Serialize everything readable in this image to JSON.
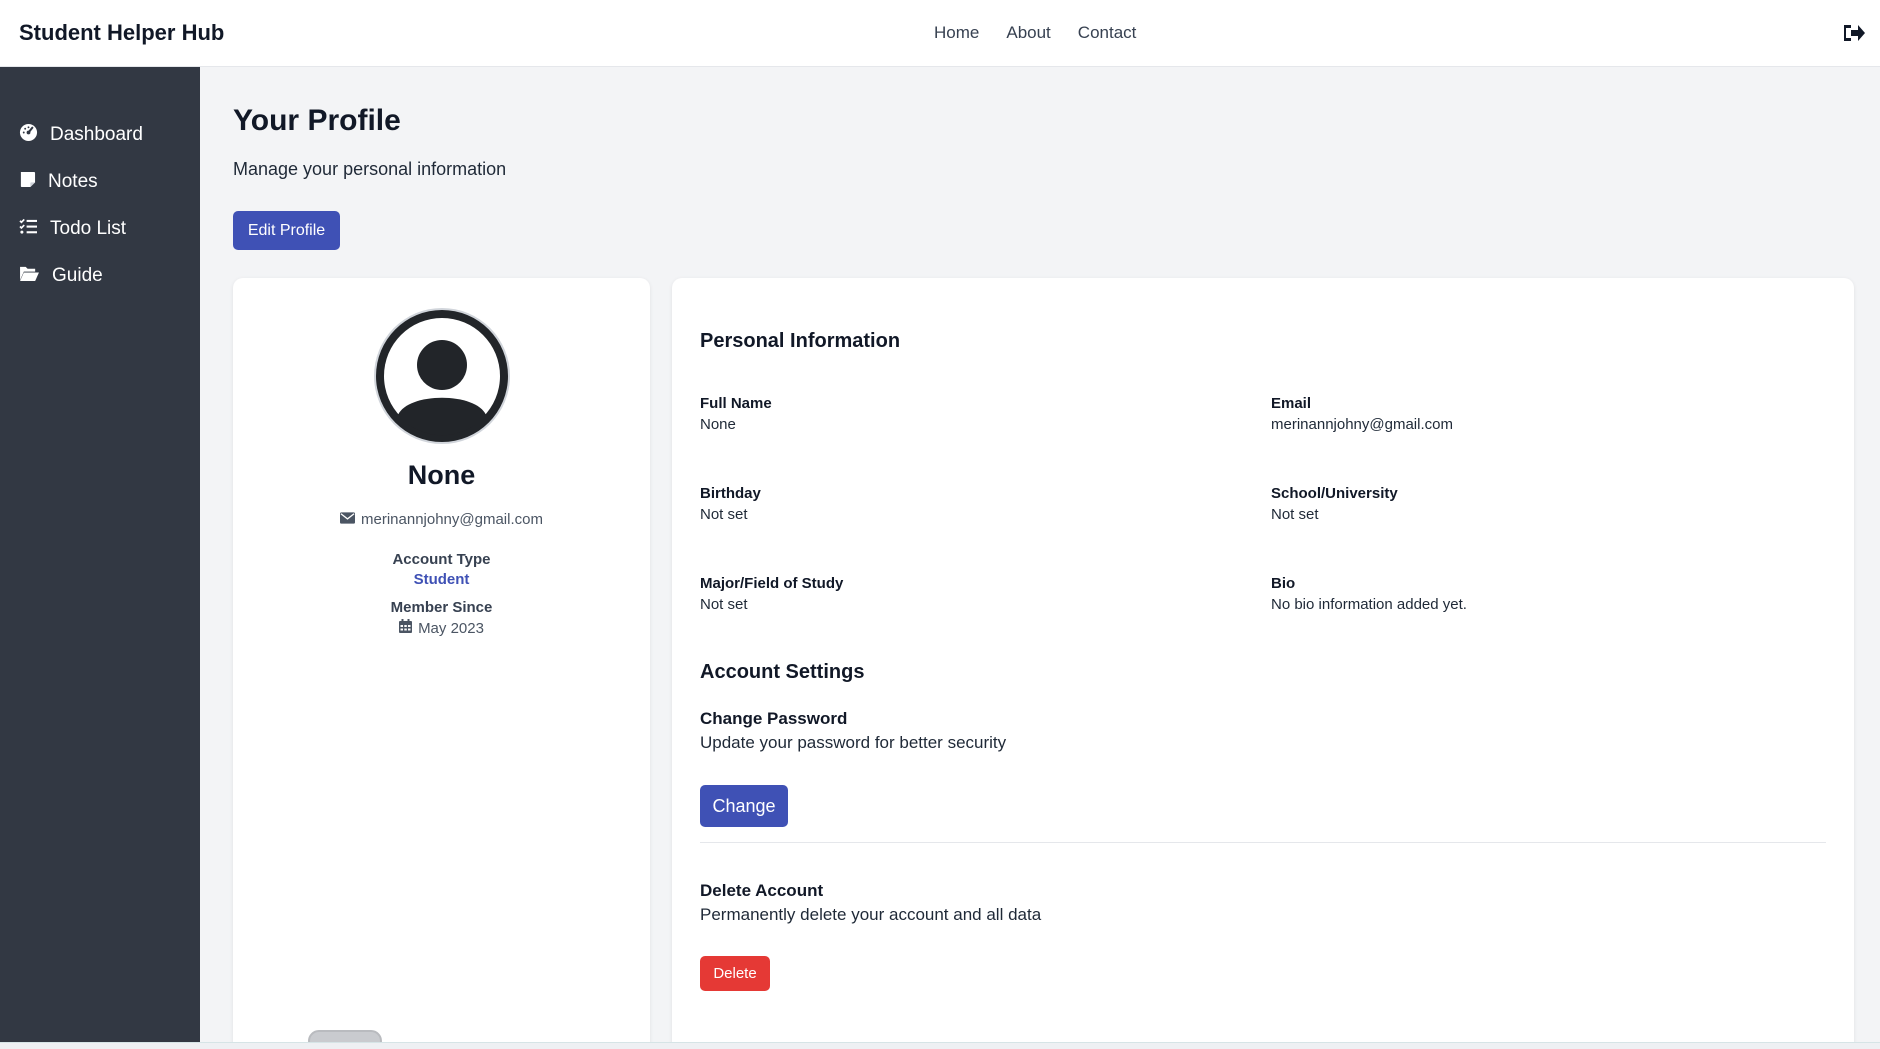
{
  "app": {
    "brand": "Student Helper Hub"
  },
  "topnav": {
    "items": [
      "Home",
      "About",
      "Contact"
    ]
  },
  "icons": {
    "logout": "sign-out-icon",
    "dashboard": "tachometer-icon",
    "notes": "sticky-note-icon",
    "todo": "list-check-icon",
    "guide": "folder-open-icon",
    "email": "envelope-icon",
    "calendar": "calendar-icon",
    "avatar": "user-circle-icon"
  },
  "sidebar": {
    "items": [
      {
        "label": "Dashboard"
      },
      {
        "label": "Notes"
      },
      {
        "label": "Todo List"
      },
      {
        "label": "Guide"
      }
    ]
  },
  "page": {
    "title": "Your Profile",
    "subtitle": "Manage your personal information",
    "edit_button": "Edit Profile"
  },
  "profile": {
    "name": "None",
    "email": "merinannjohny@gmail.com",
    "account_type_label": "Account Type",
    "account_type": "Student",
    "member_since_label": "Member Since",
    "member_since": "May 2023"
  },
  "personal": {
    "title": "Personal Information",
    "fields": [
      {
        "label": "Full Name",
        "value": "None"
      },
      {
        "label": "Email",
        "value": "merinannjohny@gmail.com"
      },
      {
        "label": "Birthday",
        "value": "Not set"
      },
      {
        "label": "School/University",
        "value": "Not set"
      },
      {
        "label": "Major/Field of Study",
        "value": "Not set"
      },
      {
        "label": "Bio",
        "value": "No bio information added yet."
      }
    ]
  },
  "settings": {
    "title": "Account Settings",
    "change_password": {
      "title": "Change Password",
      "description": "Update your password for better security",
      "button": "Change"
    },
    "delete_account": {
      "title": "Delete Account",
      "description": "Permanently delete your account and all data",
      "button": "Delete"
    }
  },
  "colors": {
    "primary": "#3f51b5",
    "danger": "#e53935",
    "sidebar_bg": "#323843",
    "page_bg": "#f3f4f6"
  }
}
